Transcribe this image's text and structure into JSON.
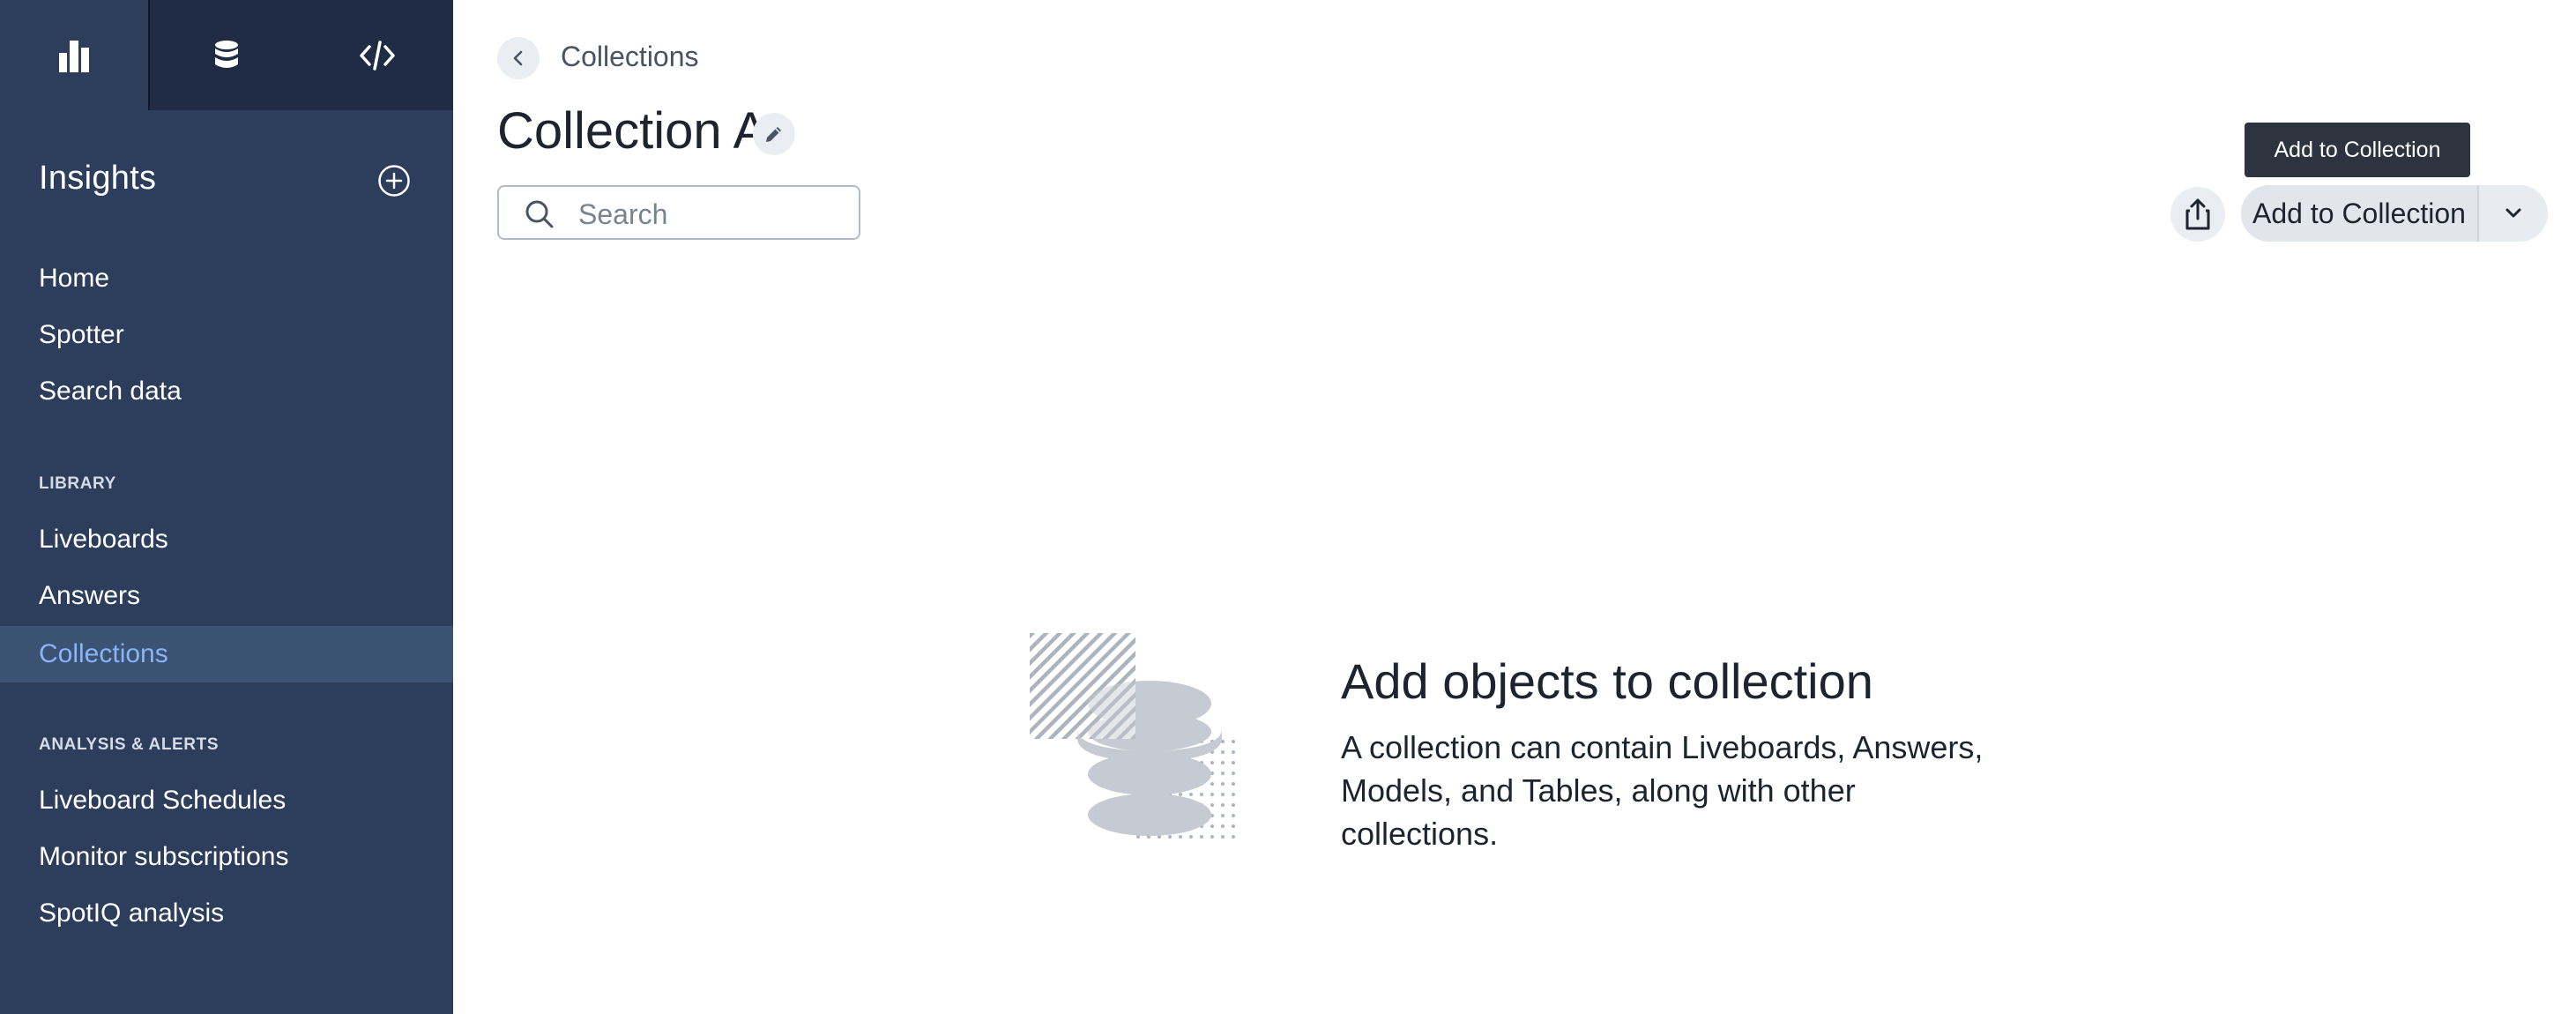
{
  "sidebar": {
    "top_tabs": [
      {
        "icon": "bar-chart-icon"
      },
      {
        "icon": "database-icon"
      },
      {
        "icon": "code-icon"
      }
    ],
    "title": "Insights",
    "add_icon": "add-circle-icon",
    "items_top": [
      {
        "label": "Home"
      },
      {
        "label": "Spotter"
      },
      {
        "label": "Search data"
      }
    ],
    "library_heading": "LIBRARY",
    "library_items": [
      {
        "label": "Liveboards"
      },
      {
        "label": "Answers"
      },
      {
        "label": "Collections",
        "active": true
      }
    ],
    "analysis_heading": "ANALYSIS & ALERTS",
    "analysis_items": [
      {
        "label": "Liveboard Schedules"
      },
      {
        "label": "Monitor subscriptions"
      },
      {
        "label": "SpotIQ analysis"
      }
    ]
  },
  "header": {
    "breadcrumb": "Collections",
    "title": "Collection A"
  },
  "search": {
    "placeholder": "Search",
    "value": ""
  },
  "actions": {
    "tooltip": "Add to Collection",
    "add_label": "Add to Collection"
  },
  "empty_state": {
    "title": "Add objects to collection",
    "line1": "A collection can contain Liveboards, Answers,",
    "line2": "Models, and Tables, along with other collections."
  },
  "colors": {
    "sidebar_bg": "#2c3e5c",
    "sidebar_top_bg": "#1f2c43",
    "active_item_bg": "#3b5273",
    "active_item_text": "#8ab4f8",
    "tooltip_bg": "#2d3440"
  }
}
